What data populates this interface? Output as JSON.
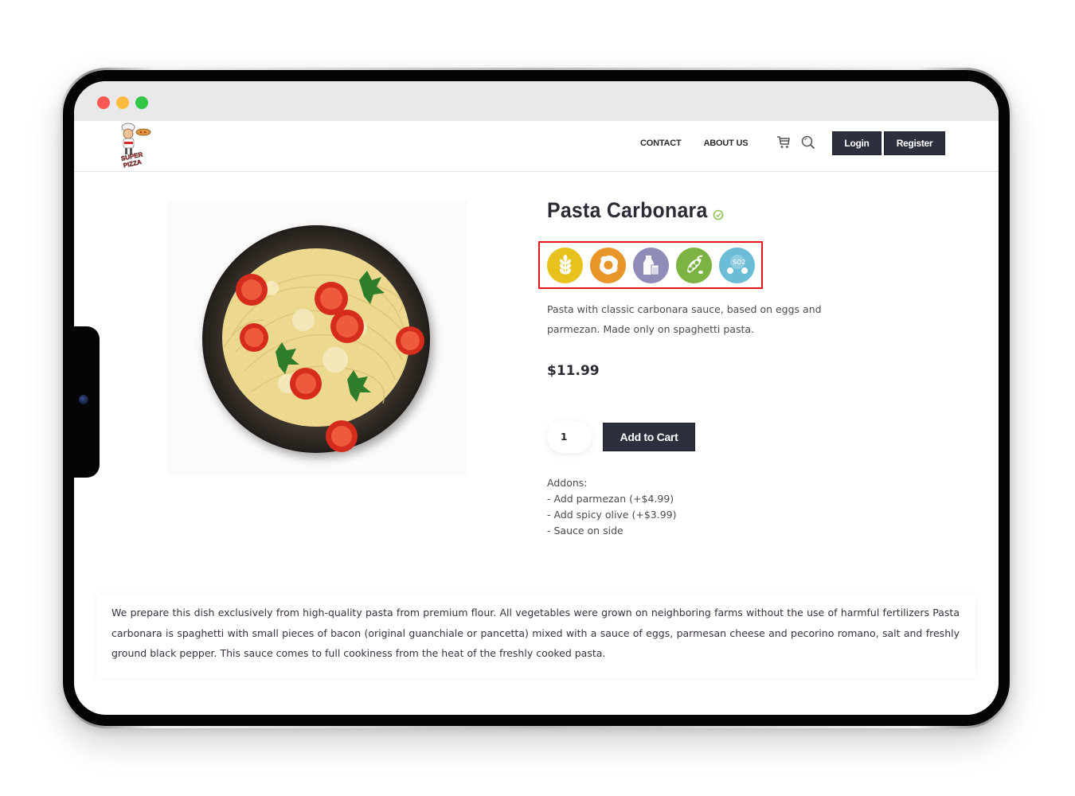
{
  "browser": {
    "window_controls": [
      "close",
      "minimize",
      "maximize"
    ]
  },
  "header": {
    "logo_alt": "Super Pizza",
    "nav": [
      {
        "label": "CONTACT"
      },
      {
        "label": "ABOUT US"
      }
    ],
    "icons": [
      "cart-icon",
      "search-icon"
    ],
    "login_label": "Login",
    "register_label": "Register"
  },
  "product": {
    "title": "Pasta Carbonara",
    "verified_icon": "check-circle-icon",
    "image_alt": "Plate of spaghetti with parmesan, cherry tomatoes and parsley",
    "allergens": [
      {
        "name": "gluten",
        "icon": "wheat-icon",
        "color": "#e8c21c"
      },
      {
        "name": "eggs",
        "icon": "egg-icon",
        "color": "#e8962a"
      },
      {
        "name": "milk",
        "icon": "milk-icon",
        "color": "#8f8db8"
      },
      {
        "name": "soy",
        "icon": "soybean-icon",
        "color": "#7cb342"
      },
      {
        "name": "sulphites",
        "icon": "so2-icon",
        "color": "#6bbcd6",
        "text": "SO2"
      }
    ],
    "allergen_highlight_color": "#e8141b",
    "description": "Pasta with classic carbonara sauce, based on eggs and parmezan. Made only on spaghetti pasta.",
    "price": "$11.99",
    "quantity": "1",
    "add_to_cart_label": "Add to Cart",
    "addons_title": "Addons:",
    "addons": [
      "- Add parmezan (+$4.99)",
      "- Add spicy olive (+$3.99)",
      "- Sauce on side"
    ]
  },
  "long_description": "We prepare this dish exclusively from high-quality pasta from premium flour. All vegetables were grown on neighboring farms without the use of harmful fertilizers Pasta carbonara is spaghetti with small pieces of bacon (original guanchiale or pancetta) mixed with a sauce of eggs, parmesan cheese and pecorino romano, salt and freshly ground black pepper. This sauce comes to full cookiness from the heat of the freshly cooked pasta.",
  "colors": {
    "button_dark": "#2c2f3d",
    "text_dark": "#2b2b35",
    "verified_green": "#8bc34a"
  }
}
